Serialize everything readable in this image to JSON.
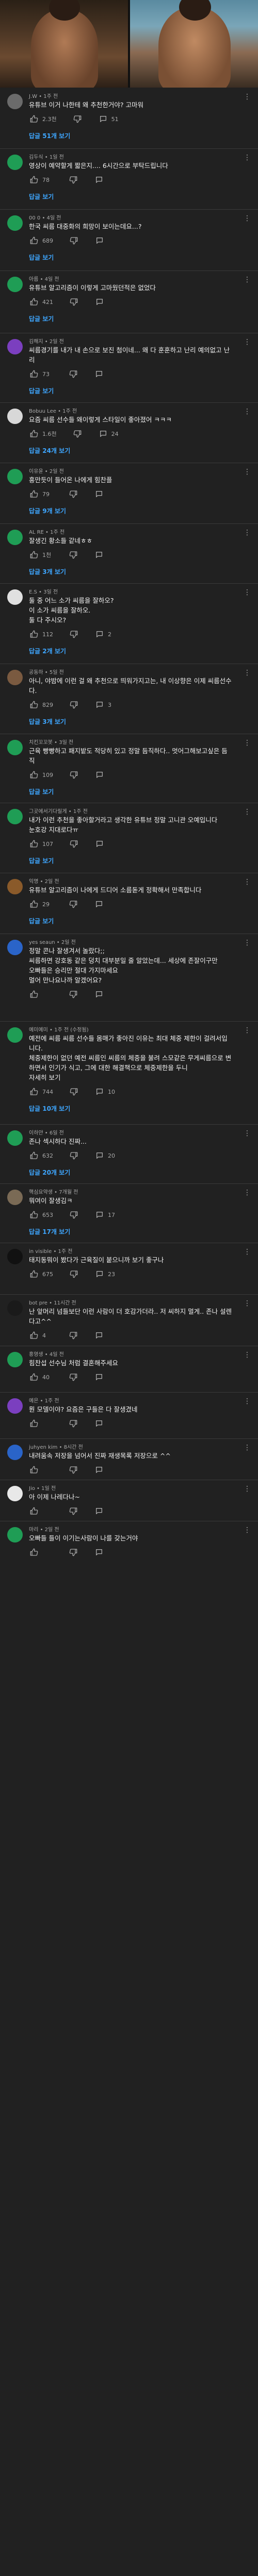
{
  "colors": {
    "background": "#212121",
    "link": "#3ea6ff",
    "meta": "#aaaaaa"
  },
  "comments": [
    {
      "author": "J.W",
      "time": "1주 전",
      "text": "유튜브 이거 나한테 왜 추천한거야? 고마워",
      "likes": "2.3천",
      "replies_count": "51",
      "replies": "답글 51개 보기"
    },
    {
      "author": "김두식",
      "time": "1일 전",
      "text": "영상이 예약할게 짧은지.... 6시간으로 부탁드립니다",
      "likes": "78",
      "replies_count": "",
      "replies": "답글 보기"
    },
    {
      "author": "00 0",
      "time": "4일 전",
      "text": "한국 씨름 대중화의 희망이 보이는데요...?",
      "likes": "689",
      "replies_count": "",
      "replies": "답글 보기"
    },
    {
      "author": "아름",
      "time": "4일 전",
      "text": "유튜브 알고리즘이 이렇게 고마웠던적은 없었다",
      "likes": "421",
      "replies_count": "",
      "replies": "답글 보기"
    },
    {
      "author": "김해지",
      "time": "2일 전",
      "text": "씨름경기를 내가 내 손으로 보진 첨이네... 왜 다 훈훈하고 난리 예의없고 난리",
      "likes": "73",
      "replies_count": "",
      "replies": "답글 보기"
    },
    {
      "author": "Bobuu Lee",
      "time": "1주 전",
      "text": "요즘 씨름 선수들 왜이렇게 스타일이 좋아졌어 ㅋㅋㅋ",
      "likes": "1.6천",
      "replies_count": "24",
      "replies": "답글 24개 보기"
    },
    {
      "author": "이유윤",
      "time": "2일 전",
      "text": "흥만듯이 들어온 나에게 힘찬플",
      "likes": "79",
      "replies_count": "",
      "replies": "답글 9개 보기"
    },
    {
      "author": "AL RE",
      "time": "1주 전",
      "text": "잘생긴 황소들 같네ㅎㅎ",
      "likes": "1천",
      "replies_count": "",
      "replies": "답글 3개 보기"
    },
    {
      "author": "E.S",
      "time": "3일 전",
      "text": "둘 중 어느 소가 씨름을 잘하오?\n이 소가 씨름을 잘하오.\n둘 다 주시오?",
      "likes": "112",
      "replies_count": "2",
      "replies": "답글 2개 보기"
    },
    {
      "author": "공동하",
      "time": "5일 전",
      "text": "아니, 야밤에 이런 걸 왜 추천으로 띄워가지고는, 내 이상향은 이제 씨름선수다.",
      "likes": "829",
      "replies_count": "3",
      "replies": "답글 3개 보기"
    },
    {
      "author": "치킨꼬꼬봇",
      "time": "3일 전",
      "text": "근육 빵빵하고 패지밭도 적당히 있고 정말 듬직하다.. 멋어그해보고싶은 듬직",
      "likes": "109",
      "replies_count": "",
      "replies": "답글 보기"
    },
    {
      "author": "그곳에서기다릴게",
      "time": "1주 전",
      "text": "내가 이런 추천을 좋아할거라고 생각한 유튜브 정말 고니관 오예입니다\n눈호강 지대로다ㅠ",
      "likes": "107",
      "replies_count": "",
      "replies": "답글 보기"
    },
    {
      "author": "익명",
      "time": "2일 전",
      "text": "유튜브 알고리즘이 나에게 드디어 소름돋게 정확해서 만족합니다",
      "likes": "29",
      "replies_count": "",
      "replies": "답글 보기"
    },
    {
      "author": "yes seaun",
      "time": "2일 전",
      "text": "정말 콘나 잘생겨서 놀랐다;;\n씨름하면 강호동 같은 덩치 대부분일 줄 알았는데... 세상에 존잘이구만\n오빠들은 승리만 절대 가지마세요\n멀어 만나요나까 알겠어요?",
      "likes": "",
      "replies_count": "",
      "replies": ""
    },
    {
      "author": "예미예미",
      "time": "1주 전 (수정됨)",
      "text": "예전에 씨름 씨름 선수들 몸매가 좋아진 이유는 최대 체중 제한이 걸려서입니다.\n체중제한이 없던 예전 씨름인 씨름의 체중을 불려 스모같은 무게씨름으로 변하면서 인기가 식고, 그에 대한 해결책으로 체중제한을 두니\n자세히 보기",
      "likes": "744",
      "replies_count": "10",
      "replies": "답글 10개 보기"
    },
    {
      "author": "이하얀",
      "time": "6일 전",
      "text": "존나 섹시하다 진짜...",
      "likes": "632",
      "replies_count": "20",
      "replies": "답글 20개 보기"
    },
    {
      "author": "핵심요약생",
      "time": "7개월 전",
      "text": "뭐여이 잘생김ㅋ",
      "likes": "653",
      "replies_count": "17",
      "replies": "답글 17개 보기"
    },
    {
      "author": "in visible",
      "time": "1주 전",
      "text": "태지동뭐이 봤다가 근육질이 붙으니까 보기 좋구나",
      "likes": "675",
      "replies_count": "23",
      "replies": ""
    },
    {
      "author": "bot pre",
      "time": "11시간 전",
      "text": "난 앞머리 넘들보단 이런 사람이 더 호감가더라.. 저 씨하지 멀게.. 존나 설렌다고^^",
      "likes": "4",
      "replies_count": "",
      "replies": ""
    },
    {
      "author": "홍영생",
      "time": "4일 전",
      "text": "힘찬섭 선수님 처럼 결혼해주세요",
      "likes": "40",
      "replies_count": "",
      "replies": ""
    },
    {
      "author": "예은",
      "time": "1주 전",
      "text": "뭔 모델이야? 요즘은 구들은 다 잘생겼네",
      "likes": "",
      "replies_count": "",
      "replies": ""
    },
    {
      "author": "juhyen kim",
      "time": "8시간 전",
      "text": "내려움속 저장을 넘어서 진짜 재생목록 저장으로 ^^",
      "likes": "",
      "replies_count": "",
      "replies": ""
    },
    {
      "author": "Jio",
      "time": "1일 전",
      "text": "아 이제 나레다나~",
      "likes": "",
      "replies_count": "",
      "replies": ""
    },
    {
      "author": "마리",
      "time": "2일 전",
      "text": "오빠들 들이 이기는사람이 나를 갖는거야",
      "likes": "",
      "replies_count": "",
      "replies": ""
    }
  ]
}
